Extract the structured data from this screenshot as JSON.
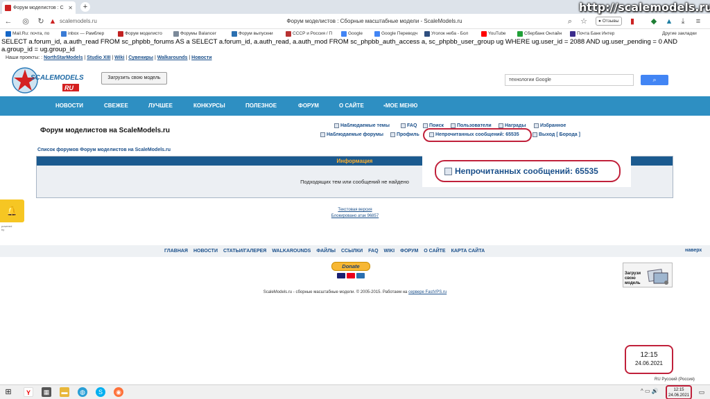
{
  "browser": {
    "tab_title": "Форум моделистов : С",
    "address": "scalemodels.ru",
    "page_title": "Форум моделистов : Сборные масштабные модели - ScaleModels.ru",
    "reviews_label": "Отзывы",
    "other_bookmarks": "Другие закладки",
    "bookmarks": [
      {
        "label": "Mail.Ru: почта, по",
        "color": "#1466c7"
      },
      {
        "label": "inbox — Рамблер",
        "color": "#3a7bd5"
      },
      {
        "label": "Форум моделисто",
        "color": "#c22222"
      },
      {
        "label": "Форумы Balancer",
        "color": "#7c8a9a"
      },
      {
        "label": "Форум выпускни",
        "color": "#2a6fb0"
      },
      {
        "label": "СССР и Россия / П",
        "color": "#b83232"
      },
      {
        "label": "Google",
        "color": "#4285f4"
      },
      {
        "label": "Google Переводч",
        "color": "#4285f4"
      },
      {
        "label": "Уголок неба - Бол",
        "color": "#2f4f7f"
      },
      {
        "label": "YouTube",
        "color": "#ff0000"
      },
      {
        "label": "Сбербанк Онлайн",
        "color": "#21a038"
      },
      {
        "label": "Почта Банк Интер",
        "color": "#3b2c8c"
      }
    ]
  },
  "sql_text": "SELECT a.forum_id, a.auth_read FROM sc_phpbb_forums AS a SELECT a.forum_id, a.auth_read, a.auth_mod FROM sc_phpbb_auth_access a, sc_phpbb_user_group ug WHERE ug.user_id = 2088 AND ug.user_pending = 0 AND a.group_id = ug.group_id",
  "projects": {
    "label": "Наши проекты: :",
    "links": [
      "NorthStarModels",
      "Studio XIII",
      "Wiki",
      "Сувениры",
      "Walkarounds",
      "Новости"
    ]
  },
  "header": {
    "upload_button": "Загрузить свою модель",
    "search_placeholder": "технологии Google"
  },
  "nav": [
    "НОВОСТИ",
    "СВЕЖЕЕ",
    "ЛУЧШЕЕ",
    "КОНКУРСЫ",
    "ПОЛЕЗНОЕ",
    "ФОРУМ",
    "О САЙТЕ",
    "МОЕ МЕНЮ"
  ],
  "forum": {
    "title": "Форум моделистов на ScaleModels.ru",
    "links_row1": [
      "Наблюдаемые темы",
      "FAQ",
      "Поиск",
      "Пользователи",
      "Награды",
      "Избранное"
    ],
    "links_row2": [
      "Наблюдаемые форумы",
      "Профиль",
      "Непрочитанных сообщений: 65535",
      "Выход [ Борода ]"
    ],
    "list_link": "Список форумов Форум моделистов на ScaleModels.ru",
    "info_header": "Информация",
    "info_message": "Подходящих тем или сообщений не найдено",
    "zoom_text": "Непрочитанных сообщений: 65535",
    "text_version": "Текстовая версия",
    "blocked": "Блокировано атак 96857"
  },
  "footer": {
    "nav": [
      "ГЛАВНАЯ",
      "НОВОСТИ",
      "СТАТЬИ/ГАЛЕРЕЯ",
      "WALKAROUNDS",
      "ФАЙЛЫ",
      "ССЫЛКИ",
      "FAQ",
      "WIKI",
      "ФОРУМ",
      "О САЙТЕ",
      "КАРТА САЙТА"
    ],
    "top_link": "наверх",
    "donate": "Donate",
    "upload_ad": "Загрузи свою модель",
    "copyright": "ScaleModels.ru - сборные масштабные модели. © 2005-2015. Работаем на",
    "host_link": "сервере FastVPS.ru"
  },
  "clock": {
    "time": "12:15",
    "date": "24.06.2021"
  },
  "taskbar": {
    "language": "RU Русский (Россия)"
  },
  "watermark": "http://scalemodels.ru"
}
